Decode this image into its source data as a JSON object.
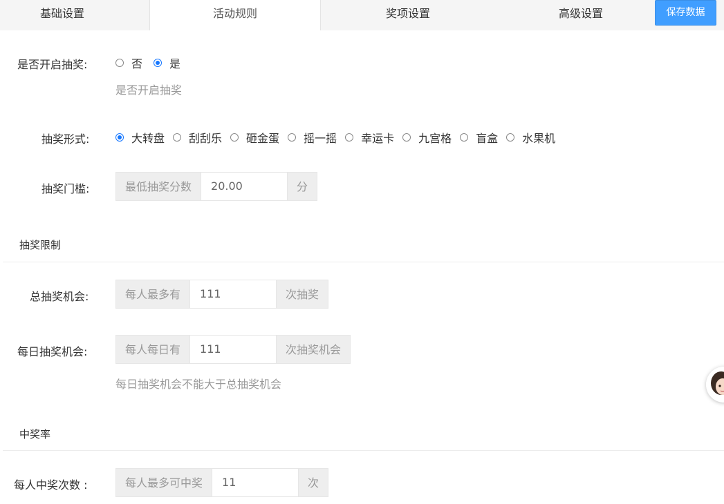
{
  "tabs": [
    {
      "label": "基础设置",
      "active": false
    },
    {
      "label": "活动规则",
      "active": true
    },
    {
      "label": "奖项设置",
      "active": false
    },
    {
      "label": "高级设置",
      "active": false
    }
  ],
  "save_button": "保存数据",
  "lottery_enable": {
    "label": "是否开启抽奖:",
    "options": [
      "否",
      "是"
    ],
    "selected": "是",
    "help": "是否开启抽奖"
  },
  "lottery_form": {
    "label": "抽奖形式:",
    "options": [
      "大转盘",
      "刮刮乐",
      "砸金蛋",
      "摇一摇",
      "幸运卡",
      "九宫格",
      "盲盒",
      "水果机"
    ],
    "selected": "大转盘"
  },
  "threshold": {
    "label": "抽奖门槛:",
    "prefix": "最低抽奖分数",
    "value": "20.00",
    "suffix": "分"
  },
  "limits_section": "抽奖限制",
  "total_chances": {
    "label": "总抽奖机会:",
    "prefix": "每人最多有",
    "value": "111",
    "suffix": "次抽奖"
  },
  "daily_chances": {
    "label": "每日抽奖机会:",
    "prefix": "每人每日有",
    "value": "111",
    "suffix": "次抽奖机会",
    "help": "每日抽奖机会不能大于总抽奖机会"
  },
  "win_rate_section": "中奖率",
  "win_times": {
    "label": "每人中奖次数 :",
    "prefix": "每人最多可中奖",
    "value": "11",
    "suffix": "次"
  },
  "colors": {
    "accent": "#409eff",
    "radio": "#1677ff"
  },
  "icons": {
    "avatar": "support-avatar-icon"
  }
}
